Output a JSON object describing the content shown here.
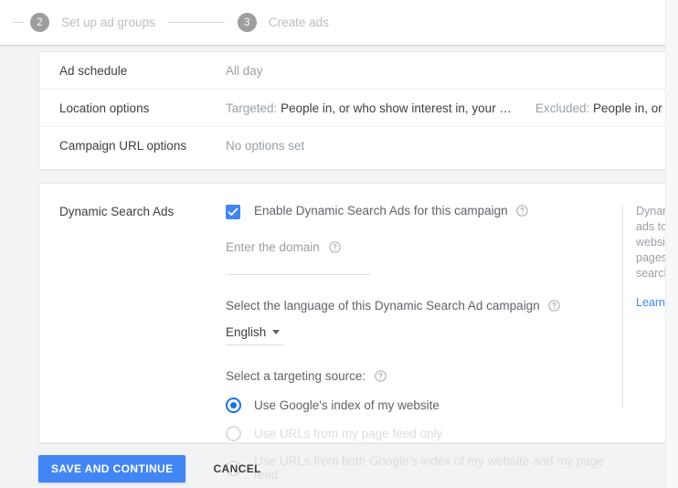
{
  "stepper": {
    "steps": [
      {
        "number": "2",
        "label": "Set up ad groups"
      },
      {
        "number": "3",
        "label": "Create ads"
      }
    ]
  },
  "settings_card": {
    "rows": [
      {
        "label": "Ad schedule",
        "value": "All day"
      },
      {
        "label": "Location options",
        "targeted_prefix": "Targeted:",
        "targeted_value": "People in, or who show interest in, your …",
        "excluded_prefix": "Excluded:",
        "excluded_value": "People in, or who sh"
      },
      {
        "label": "Campaign URL options",
        "value": "No options set"
      }
    ]
  },
  "dsa_card": {
    "section_label": "Dynamic Search Ads",
    "enable_checkbox": {
      "label": "Enable Dynamic Search Ads for this campaign",
      "checked": true
    },
    "domain_field": {
      "caption": "Enter the domain",
      "value": "",
      "placeholder": ""
    },
    "language": {
      "caption": "Select the language of this Dynamic Search Ad campaign",
      "selected": "English"
    },
    "targeting_source": {
      "caption": "Select a targeting source:",
      "options": [
        {
          "label": "Use Google's index of my website",
          "selected": true,
          "disabled": false
        },
        {
          "label": "Use URLs from my page feed only",
          "selected": false,
          "disabled": true
        },
        {
          "label": "Use URLs from both Google's index of my website and my page feed",
          "selected": false,
          "disabled": true
        }
      ]
    },
    "help": {
      "text": "Dynamic Search Ads show relevant ads to customers based on your website with headlines and landing pages customized to the customer's search term.",
      "link_label": "Learn more"
    }
  },
  "footer": {
    "save_label": "SAVE AND CONTINUE",
    "cancel_label": "CANCEL"
  },
  "colors": {
    "accent_blue": "#4285f4",
    "radio_blue": "#1a73e8",
    "link_blue": "#4285f4",
    "page_bg": "#f1f3f4",
    "disabled_grey": "#dadce0"
  },
  "icons": {
    "help": "help-circle-icon",
    "caret": "chevron-down-icon",
    "check": "checkmark-icon"
  }
}
